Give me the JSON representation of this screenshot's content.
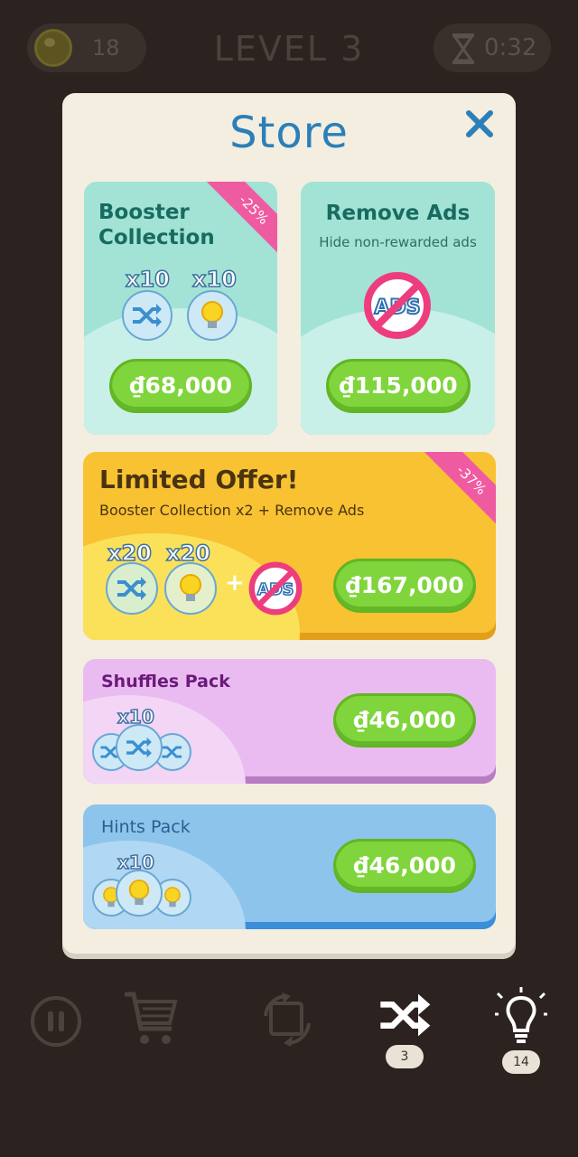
{
  "hud": {
    "coins": "18",
    "level": "LEVEL 3",
    "timer": "0:32"
  },
  "store": {
    "title": "Store",
    "booster": {
      "title_line1": "Booster",
      "title_line2": "Collection",
      "discount": "-25%",
      "shuffle_qty": "x10",
      "hint_qty": "x10",
      "price": "₫68,000"
    },
    "remove_ads": {
      "title": "Remove Ads",
      "subtitle": "Hide non-rewarded ads",
      "price": "₫115,000"
    },
    "limited": {
      "title": "Limited Offer!",
      "subtitle": "Booster Collection x2 + Remove Ads",
      "discount": "-37%",
      "shuffle_qty": "x20",
      "hint_qty": "x20",
      "plus": "+",
      "price": "₫167,000"
    },
    "shuffles": {
      "title": "Shuffles Pack",
      "qty": "x10",
      "price": "₫46,000"
    },
    "hints": {
      "title": "Hints Pack",
      "qty": "x10",
      "price": "₫46,000"
    }
  },
  "bottom_bar": {
    "shuffle_count": "3",
    "hint_count": "14"
  },
  "ads_label": "ADS",
  "colors": {
    "store_title": "#2c7fb8",
    "booster_card": "#a2e3d6",
    "limited_card": "#f8c233",
    "shuffles_card": "#eabbf0",
    "hints_card": "#8cc4ec",
    "price_button": "#7fd53b",
    "ribbon": "#ef5ba1"
  }
}
